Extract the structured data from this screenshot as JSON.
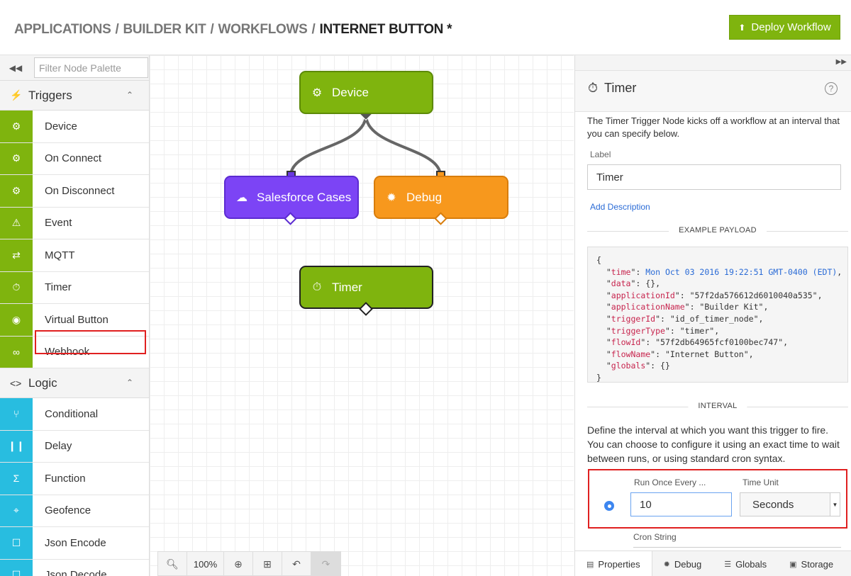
{
  "header": {
    "breadcrumb": [
      "APPLICATIONS",
      "BUILDER KIT",
      "WORKFLOWS"
    ],
    "current": "INTERNET BUTTON *",
    "deploy_label": "Deploy Workflow"
  },
  "palette": {
    "filter_placeholder": "Filter Node Palette",
    "triggers": {
      "title": "Triggers",
      "items": [
        {
          "label": "Device",
          "icon": "chip-icon"
        },
        {
          "label": "On Connect",
          "icon": "chip-icon"
        },
        {
          "label": "On Disconnect",
          "icon": "chip-icon"
        },
        {
          "label": "Event",
          "icon": "warning-icon"
        },
        {
          "label": "MQTT",
          "icon": "arrows-icon"
        },
        {
          "label": "Timer",
          "icon": "stopwatch-icon"
        },
        {
          "label": "Virtual Button",
          "icon": "radio-button-icon"
        },
        {
          "label": "Webhook",
          "icon": "link-icon"
        }
      ]
    },
    "logic": {
      "title": "Logic",
      "items": [
        {
          "label": "Conditional",
          "icon": "branch-icon"
        },
        {
          "label": "Delay",
          "icon": "pause-icon"
        },
        {
          "label": "Function",
          "icon": "sigma-icon"
        },
        {
          "label": "Geofence",
          "icon": "crosshair-icon"
        },
        {
          "label": "Json Encode",
          "icon": "doc-icon"
        },
        {
          "label": "Json Decode",
          "icon": "doc-icon"
        }
      ]
    }
  },
  "canvas": {
    "nodes": {
      "device": "Device",
      "salesforce": "Salesforce Cases",
      "debug": "Debug",
      "timer": "Timer"
    },
    "zoom": "100%"
  },
  "panel": {
    "title": "Timer",
    "description": "The Timer Trigger Node kicks off a workflow at an interval that you can specify below.",
    "label_caption": "Label",
    "label_value": "Timer",
    "add_description": "Add Description",
    "example_payload_heading": "EXAMPLE PAYLOAD",
    "payload": {
      "time": "Mon Oct 03 2016 19:22:51 GMT-0400 (EDT)",
      "data": "{}",
      "applicationId": "\"57f2da576612d6010040a535\"",
      "applicationName": "\"Builder Kit\"",
      "triggerId": "\"id_of_timer_node\"",
      "triggerType": "\"timer\"",
      "flowId": "\"57f2db64965fcf0100bec747\"",
      "flowName": "\"Internet Button\"",
      "globals": "{}"
    },
    "interval_heading": "INTERVAL",
    "interval_description": "Define the interval at which you want this trigger to fire. You can choose to configure it using an exact time to wait between runs, or using standard cron syntax.",
    "run_once_label": "Run Once Every ...",
    "run_once_value": "10",
    "time_unit_label": "Time Unit",
    "time_unit_value": "Seconds",
    "cron_label": "Cron String",
    "tabs": [
      "Properties",
      "Debug",
      "Globals",
      "Storage"
    ]
  }
}
